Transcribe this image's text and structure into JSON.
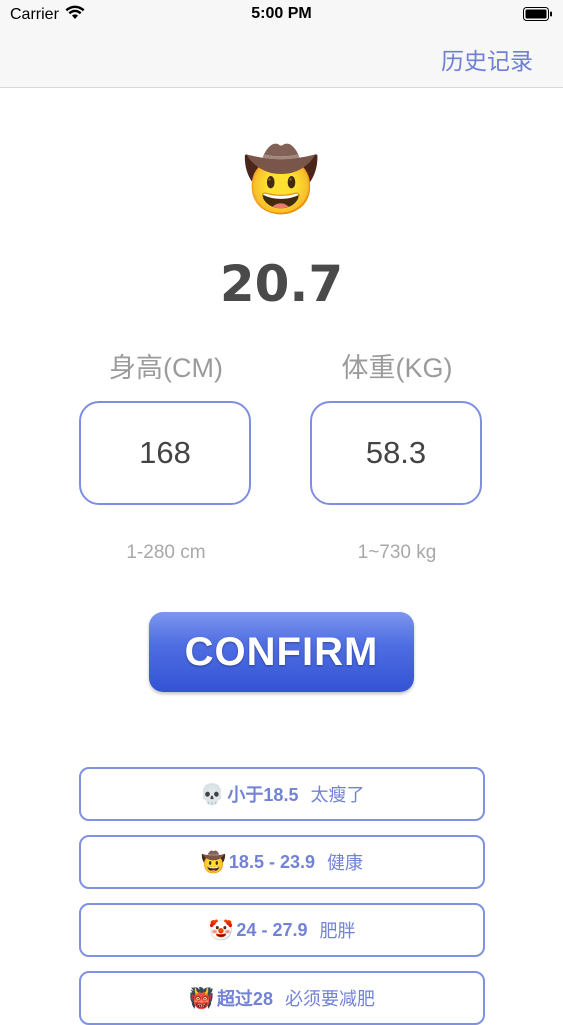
{
  "status_bar": {
    "carrier": "Carrier",
    "time": "5:00 PM"
  },
  "nav": {
    "history_label": "历史记录"
  },
  "result": {
    "emoji": "🤠",
    "bmi": "20.7"
  },
  "height": {
    "label": "身高(CM)",
    "value": "168",
    "hint": "1-280 cm"
  },
  "weight": {
    "label": "体重(KG)",
    "value": "58.3",
    "hint": "1~730 kg"
  },
  "confirm_label": "CONFIRM",
  "ranges": [
    {
      "emoji": "💀",
      "range": "小于18.5",
      "desc": "太瘦了"
    },
    {
      "emoji": "🤠",
      "range": "18.5 - 23.9",
      "desc": "健康"
    },
    {
      "emoji": "🤡",
      "range": "24 - 27.9",
      "desc": "肥胖"
    },
    {
      "emoji": "👹",
      "range": "超过28",
      "desc": "必须要减肥"
    }
  ],
  "colors": {
    "accent": "#6d7fd6",
    "button_top": "#7d96ee",
    "button_bottom": "#3453d4",
    "border": "#7f8ee0"
  }
}
